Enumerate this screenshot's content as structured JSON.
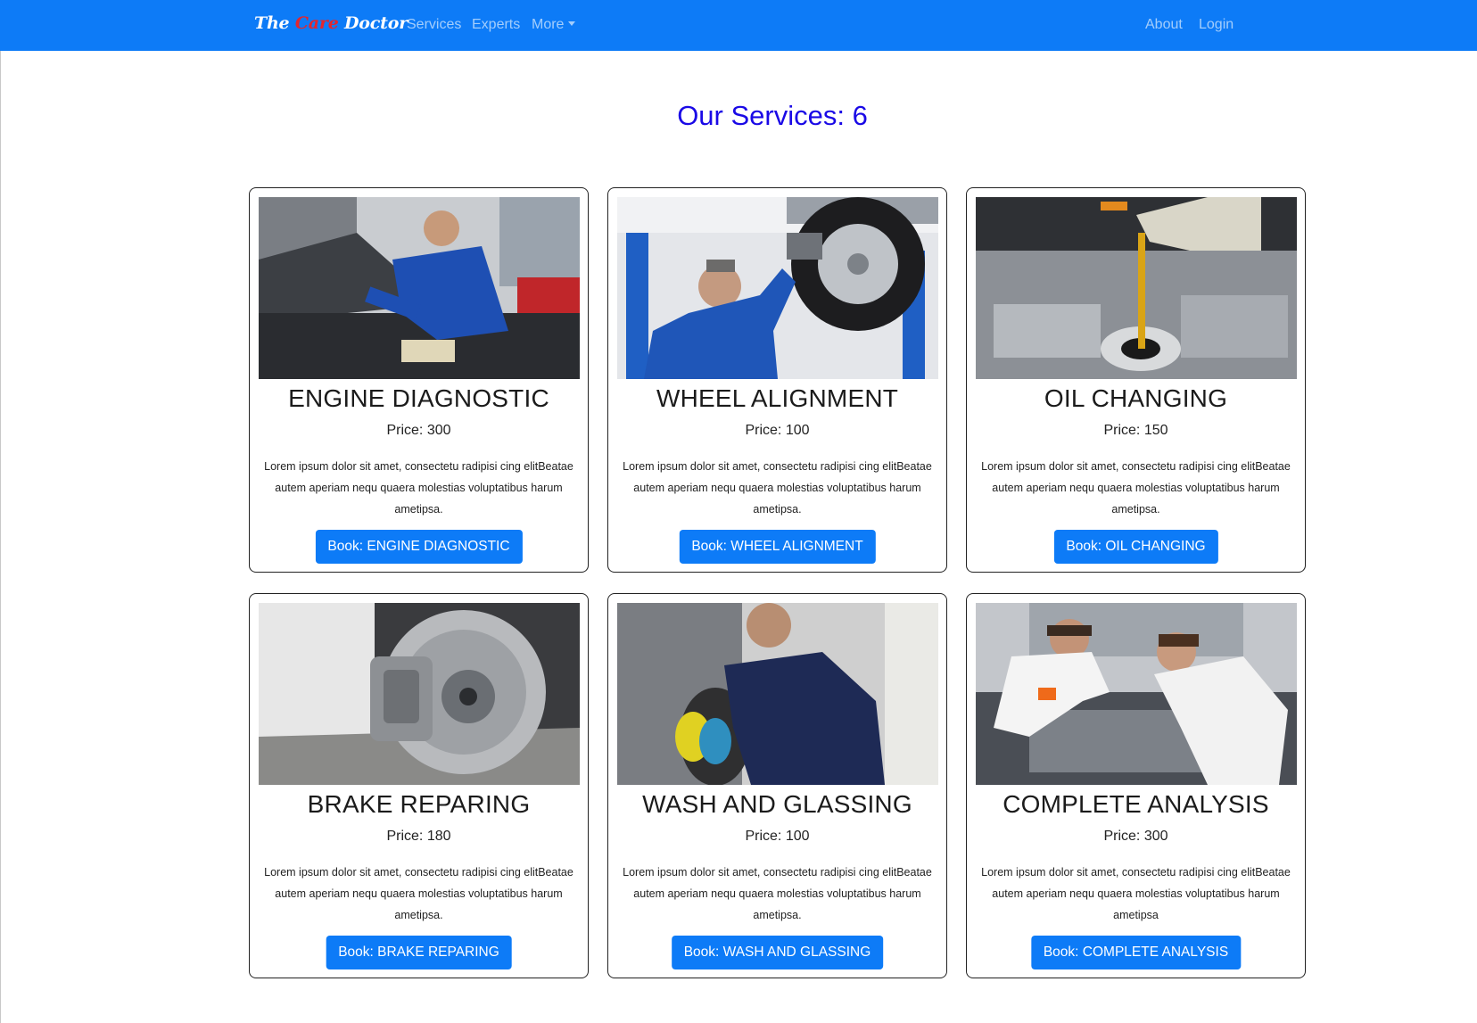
{
  "navbar": {
    "brand_pre": "The",
    "brand_mid": "Care",
    "brand_post": "Doctor",
    "links": [
      "Services",
      "Experts",
      "More"
    ],
    "right_links": [
      "About",
      "Login"
    ]
  },
  "heading": "Our Services: 6",
  "services": [
    {
      "title": "ENGINE DIAGNOSTIC",
      "price": "Price: 300",
      "desc": "Lorem ipsum dolor sit amet, consectetu radipisi cing elitBeatae autem aperiam nequ quaera molestias voluptatibus harum ametipsa.",
      "button": "Book: ENGINE DIAGNOSTIC",
      "image_icon": "mechanic-engine-photo"
    },
    {
      "title": "WHEEL ALIGNMENT",
      "price": "Price: 100",
      "desc": "Lorem ipsum dolor sit amet, consectetu radipisi cing elitBeatae autem aperiam nequ quaera molestias voluptatibus harum ametipsa.",
      "button": "Book: WHEEL ALIGNMENT",
      "image_icon": "wheel-service-photo"
    },
    {
      "title": "OIL CHANGING",
      "price": "Price: 150",
      "desc": "Lorem ipsum dolor sit amet, consectetu radipisi cing elitBeatae autem aperiam nequ quaera molestias voluptatibus harum ametipsa.",
      "button": "Book: OIL CHANGING",
      "image_icon": "oil-pour-photo"
    },
    {
      "title": "BRAKE REPARING",
      "price": "Price: 180",
      "desc": "Lorem ipsum dolor sit amet, consectetu radipisi cing elitBeatae autem aperiam nequ quaera molestias voluptatibus harum ametipsa.",
      "button": "Book: BRAKE REPARING",
      "image_icon": "brake-disc-photo"
    },
    {
      "title": "WASH AND GLASSING",
      "price": "Price: 100",
      "desc": "Lorem ipsum dolor sit amet, consectetu radipisi cing elitBeatae autem aperiam nequ quaera molestias voluptatibus harum ametipsa.",
      "button": "Book: WASH AND GLASSING",
      "image_icon": "car-polish-photo"
    },
    {
      "title": "COMPLETE ANALYSIS",
      "price": "Price: 300",
      "desc": "Lorem ipsum dolor sit amet, consectetu radipisi cing elitBeatae autem aperiam nequ quaera molestias voluptatibus harum ametipsa",
      "button": "Book: COMPLETE ANALYSIS",
      "image_icon": "two-mechanics-photo"
    }
  ],
  "colors": {
    "navbar": "#0d7bf7",
    "heading": "#1a09e6",
    "button": "#0d7bf7",
    "brand_accent": "#e3262e"
  }
}
